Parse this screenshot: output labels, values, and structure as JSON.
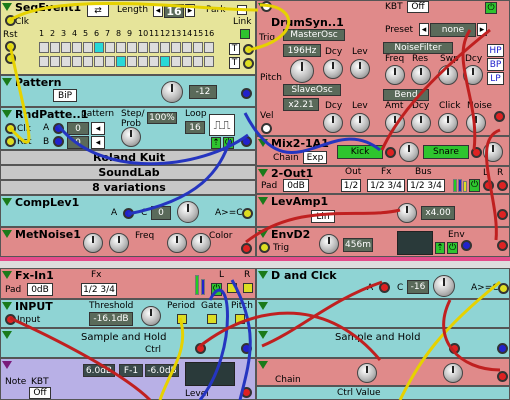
{
  "seq_event": {
    "title": "SeqEvent1",
    "length_label": "Length",
    "length": "16",
    "park": "Park",
    "link": "Link",
    "clk": "Clk",
    "rst": "Rst",
    "loop": "Loop",
    "numbers": [
      "1",
      "2",
      "3",
      "4",
      "5",
      "6",
      "7",
      "8",
      "9",
      "10",
      "11",
      "12",
      "13",
      "14",
      "15",
      "16"
    ],
    "t_btn": "T"
  },
  "drum": {
    "title": "DrumSyn..1",
    "kbt": "KBT",
    "off": "Off",
    "preset_label": "Preset",
    "preset": "none",
    "trig": "Trig",
    "master": "MasterOsc",
    "freq": "196Hz",
    "dcy": "Dcy",
    "lev": "Lev",
    "noise_filter": "NoiseFilter",
    "nf_freq": "Freq",
    "nf_res": "Res",
    "nf_swp": "Swp",
    "nf_dcy": "Dcy",
    "hp": "HP",
    "bp": "BP",
    "lp": "LP",
    "pitch": "Pitch",
    "slave": "SlaveOsc",
    "ratio": "x2.21",
    "sdcy": "Dcy",
    "slev": "Lev",
    "bend": "Bend",
    "amt": "Amt",
    "bdcy": "Dcy",
    "click": "Click",
    "noise": "Noise",
    "vel": "Vel"
  },
  "pattern": {
    "title": "Pattern",
    "bip": "BiP",
    "value": "-12"
  },
  "rnd": {
    "title": "RndPatte..1",
    "pattern": "pattern",
    "a": "A",
    "b": "B",
    "a_val": "0",
    "b_val": "0",
    "step": "Step/",
    "prob": "Prob",
    "prob_val": "100%",
    "loop": "Loop",
    "loop_val": "16",
    "clk": "Clk",
    "rst": "Rst"
  },
  "mix": {
    "title": "Mix2-1A1",
    "chain": "Chain",
    "exp": "Exp",
    "kick": "Kick",
    "snare": "Snare"
  },
  "info": {
    "line1": "Roland Kuit",
    "line2": "SoundLab",
    "line3": "8 variations"
  },
  "out": {
    "title": "2-Out1",
    "out": "Out",
    "fx": "Fx",
    "bus": "Bus",
    "pad": "Pad",
    "pad_val": "0dB",
    "out_opts": "1/2",
    "fx_opts": "1/2 3/4",
    "bus_opts": "1/2 3/4",
    "l": "L",
    "r": "R"
  },
  "comp": {
    "title": "CompLev1",
    "a": "A",
    "c": "C",
    "c_val": "0",
    "cmp": "A>=C"
  },
  "levamp": {
    "title": "LevAmp1",
    "lin": "Lin",
    "val": "x4.00"
  },
  "metnoise": {
    "title": "MetNoise1",
    "freq": "Freq",
    "color": "Color"
  },
  "env": {
    "title": "EnvD2",
    "trig": "Trig",
    "time": "456m",
    "env": "Env"
  },
  "fxin": {
    "title": "Fx-In1",
    "fx": "Fx",
    "pad": "Pad",
    "pad_val": "0dB",
    "opts": "1/2 3/4",
    "l": "L",
    "r": "R"
  },
  "dclk": {
    "title": "D and Clck",
    "a": "A",
    "c": "C",
    "c_val": "-16",
    "cmp": "A>=C"
  },
  "input": {
    "title": "INPUT",
    "threshold": "Threshold",
    "thr_val": "-16.1dB",
    "period": "Period",
    "gate": "Gate",
    "pitch": "Pitch",
    "input": "Input"
  },
  "sh1": {
    "title": "Sample and Hold",
    "ctrl": "Ctrl"
  },
  "sh2": {
    "title": "Sample and Hold"
  },
  "note": {
    "note": "Note",
    "kbt": "KBT",
    "off": "Off",
    "v1": "6.0dB",
    "v2": "F-1",
    "v3": "-6.0dB",
    "level": "Level"
  },
  "chain": {
    "chain": "Chain"
  },
  "ctrl_value": {
    "title": "Ctrl Value"
  }
}
